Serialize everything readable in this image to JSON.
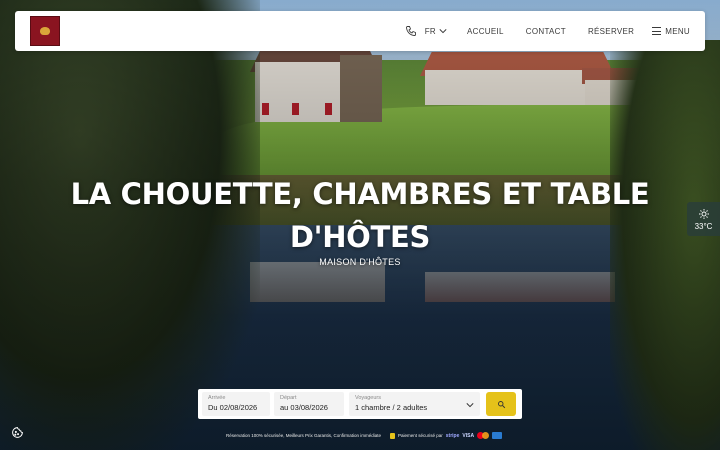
{
  "header": {
    "logo_name": "logo-icon",
    "phone_icon": "phone-icon",
    "language": "FR",
    "nav": [
      "ACCUEIL",
      "CONTACT",
      "RÉSERVER"
    ],
    "menu_label": "MENU"
  },
  "hero": {
    "title_line1": "LA CHOUETTE, CHAMBRES ET TABLE",
    "title_line2": "D'HÔTES",
    "subtitle": "MAISON D'HÔTES"
  },
  "weather": {
    "icon": "sun-icon",
    "temperature": "33°C"
  },
  "booking": {
    "arrival_label": "Arrivée",
    "arrival_value": "Du 02/08/2026",
    "departure_label": "Départ",
    "departure_value": "au 03/08/2026",
    "guests_label": "Voyageurs",
    "guests_value": "1 chambre / 2 adultes",
    "search_icon": "search-icon"
  },
  "footer": {
    "reassurance": "Réservation 100% sécurisée, Meilleurs Prix Garantis, Confirmation immédiate",
    "payment_text": "Paiement sécurisé par",
    "payment_stripe": "stripe",
    "payment_visa": "VISA"
  },
  "colors": {
    "accent": "#e5c21a",
    "logo_bg": "#8a1420",
    "header_bg": "#ffffff"
  }
}
